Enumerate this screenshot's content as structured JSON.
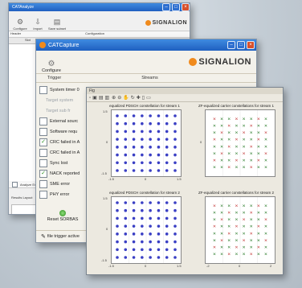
{
  "back_window": {
    "title": "CATAnalyze",
    "toolbar": [
      "Configure",
      "Import",
      "Save subset"
    ],
    "logo": "SIGNALION",
    "header_left": "Header",
    "header_right": "Configuration",
    "columns": [
      "Slot",
      "All Events",
      "Rx1 FFB",
      "HTTS"
    ],
    "config_label": "Configuration",
    "analyze_label": "Analyze Events",
    "results_label": "Results Layout"
  },
  "front_window": {
    "title": "CATCapture",
    "configure_label": "Configure",
    "logo": "SIGNALION",
    "section_trigger": "Trigger",
    "section_streams": "Streams",
    "trigger_items": [
      {
        "label": "System timer 0",
        "checked": false,
        "dim": false
      },
      {
        "label": "Target system",
        "checked": false,
        "dim": true
      },
      {
        "label": "Target sub fr",
        "checked": false,
        "dim": true
      },
      {
        "label": "External sourc",
        "checked": false,
        "dim": false
      },
      {
        "label": "Software requ",
        "checked": false,
        "dim": false
      },
      {
        "label": "CRC failed in A",
        "checked": true,
        "dim": false
      },
      {
        "label": "CRC failed in A",
        "checked": false,
        "dim": false
      },
      {
        "label": "Sync lost",
        "checked": false,
        "dim": false
      },
      {
        "label": "NACK reported",
        "checked": true,
        "dim": false
      },
      {
        "label": "SME error",
        "checked": false,
        "dim": false
      },
      {
        "label": "PHY error",
        "checked": false,
        "dim": false
      }
    ],
    "reset_label": "Reset SORBAS",
    "file_trigger_label": "file trigger active"
  },
  "plot_window": {
    "title": "Fig",
    "panels": [
      {
        "title": "equalized PDSCH constellation for stream 1"
      },
      {
        "title": "ZF-equalized carrier constellations for stream 1"
      },
      {
        "title": "equalized PDSCH constellation for stream 2"
      },
      {
        "title": "ZF-equalized carrier constellations for stream 2"
      }
    ],
    "y_ticks_left": [
      "1.5",
      "1",
      "0.5",
      "0",
      "-0.5",
      "-1",
      "-1.5"
    ],
    "x_ticks_left": [
      "-1.5",
      "-1",
      "-0.5",
      "0",
      "0.5",
      "1",
      "1.5"
    ],
    "y_ticks_right": [
      "2",
      "1",
      "0",
      "-1",
      "-2"
    ],
    "x_ticks_right": [
      "-2",
      "-1",
      "0",
      "1",
      "2"
    ],
    "colors": {
      "dots_blue": "#3a3fc4",
      "dots_red": "#c43a3a",
      "accent": "#f08a1c"
    }
  }
}
